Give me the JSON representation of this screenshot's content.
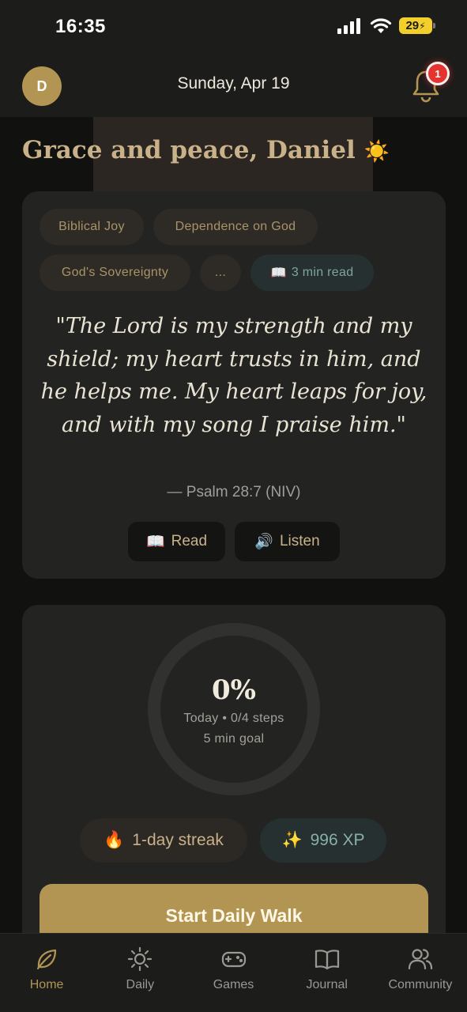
{
  "status_bar": {
    "time": "16:35",
    "battery": "29"
  },
  "header": {
    "avatar_initial": "D",
    "date": "Sunday, Apr 19",
    "notification_count": "1"
  },
  "greeting": {
    "text": "Grace and peace, Daniel",
    "emoji": "☀️"
  },
  "verse_card": {
    "tags": [
      "Biblical Joy",
      "Dependence on God",
      "God's Sovereignty",
      "..."
    ],
    "read_time_icon": "📖",
    "read_time": "3 min read",
    "verse": "\"The Lord is my strength and my shield; my heart trusts in him, and he helps me. My heart leaps for joy, and with my song I praise him.\"",
    "reference": "— Psalm 28:7 (NIV)",
    "read_icon": "📖",
    "read_label": "Read",
    "listen_icon": "🔊",
    "listen_label": "Listen"
  },
  "progress": {
    "percent_label": "0%",
    "percent": 0,
    "today_steps": "Today • 0/4 steps",
    "goal": "5 min goal",
    "streak_icon": "🔥",
    "streak": "1-day streak",
    "xp_icon": "✨",
    "xp": "996 XP",
    "start_label": "Start Daily Walk"
  },
  "tabs": [
    {
      "label": "Home",
      "icon": "leaf-icon"
    },
    {
      "label": "Daily",
      "icon": "sun-icon"
    },
    {
      "label": "Games",
      "icon": "gamepad-icon"
    },
    {
      "label": "Journal",
      "icon": "book-icon"
    },
    {
      "label": "Community",
      "icon": "users-icon"
    }
  ],
  "colors": {
    "accent": "#b29552",
    "badge": "#e5342f",
    "xp": "#88b0a6",
    "card": "#232322"
  }
}
